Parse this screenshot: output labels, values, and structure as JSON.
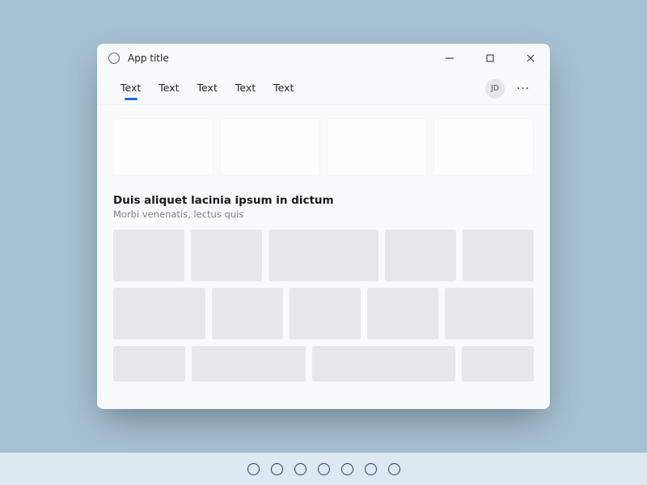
{
  "titlebar": {
    "title": "App title"
  },
  "tabs": [
    {
      "label": "Text",
      "active": true
    },
    {
      "label": "Text",
      "active": false
    },
    {
      "label": "Text",
      "active": false
    },
    {
      "label": "Text",
      "active": false
    },
    {
      "label": "Text",
      "active": false
    }
  ],
  "avatar_initials": "JD",
  "section": {
    "title": "Duis aliquet lacinia ipsum in dictum",
    "subtitle": "Morbi venenatis, lectus quis"
  },
  "taskbar": {
    "icon_count": 7
  }
}
